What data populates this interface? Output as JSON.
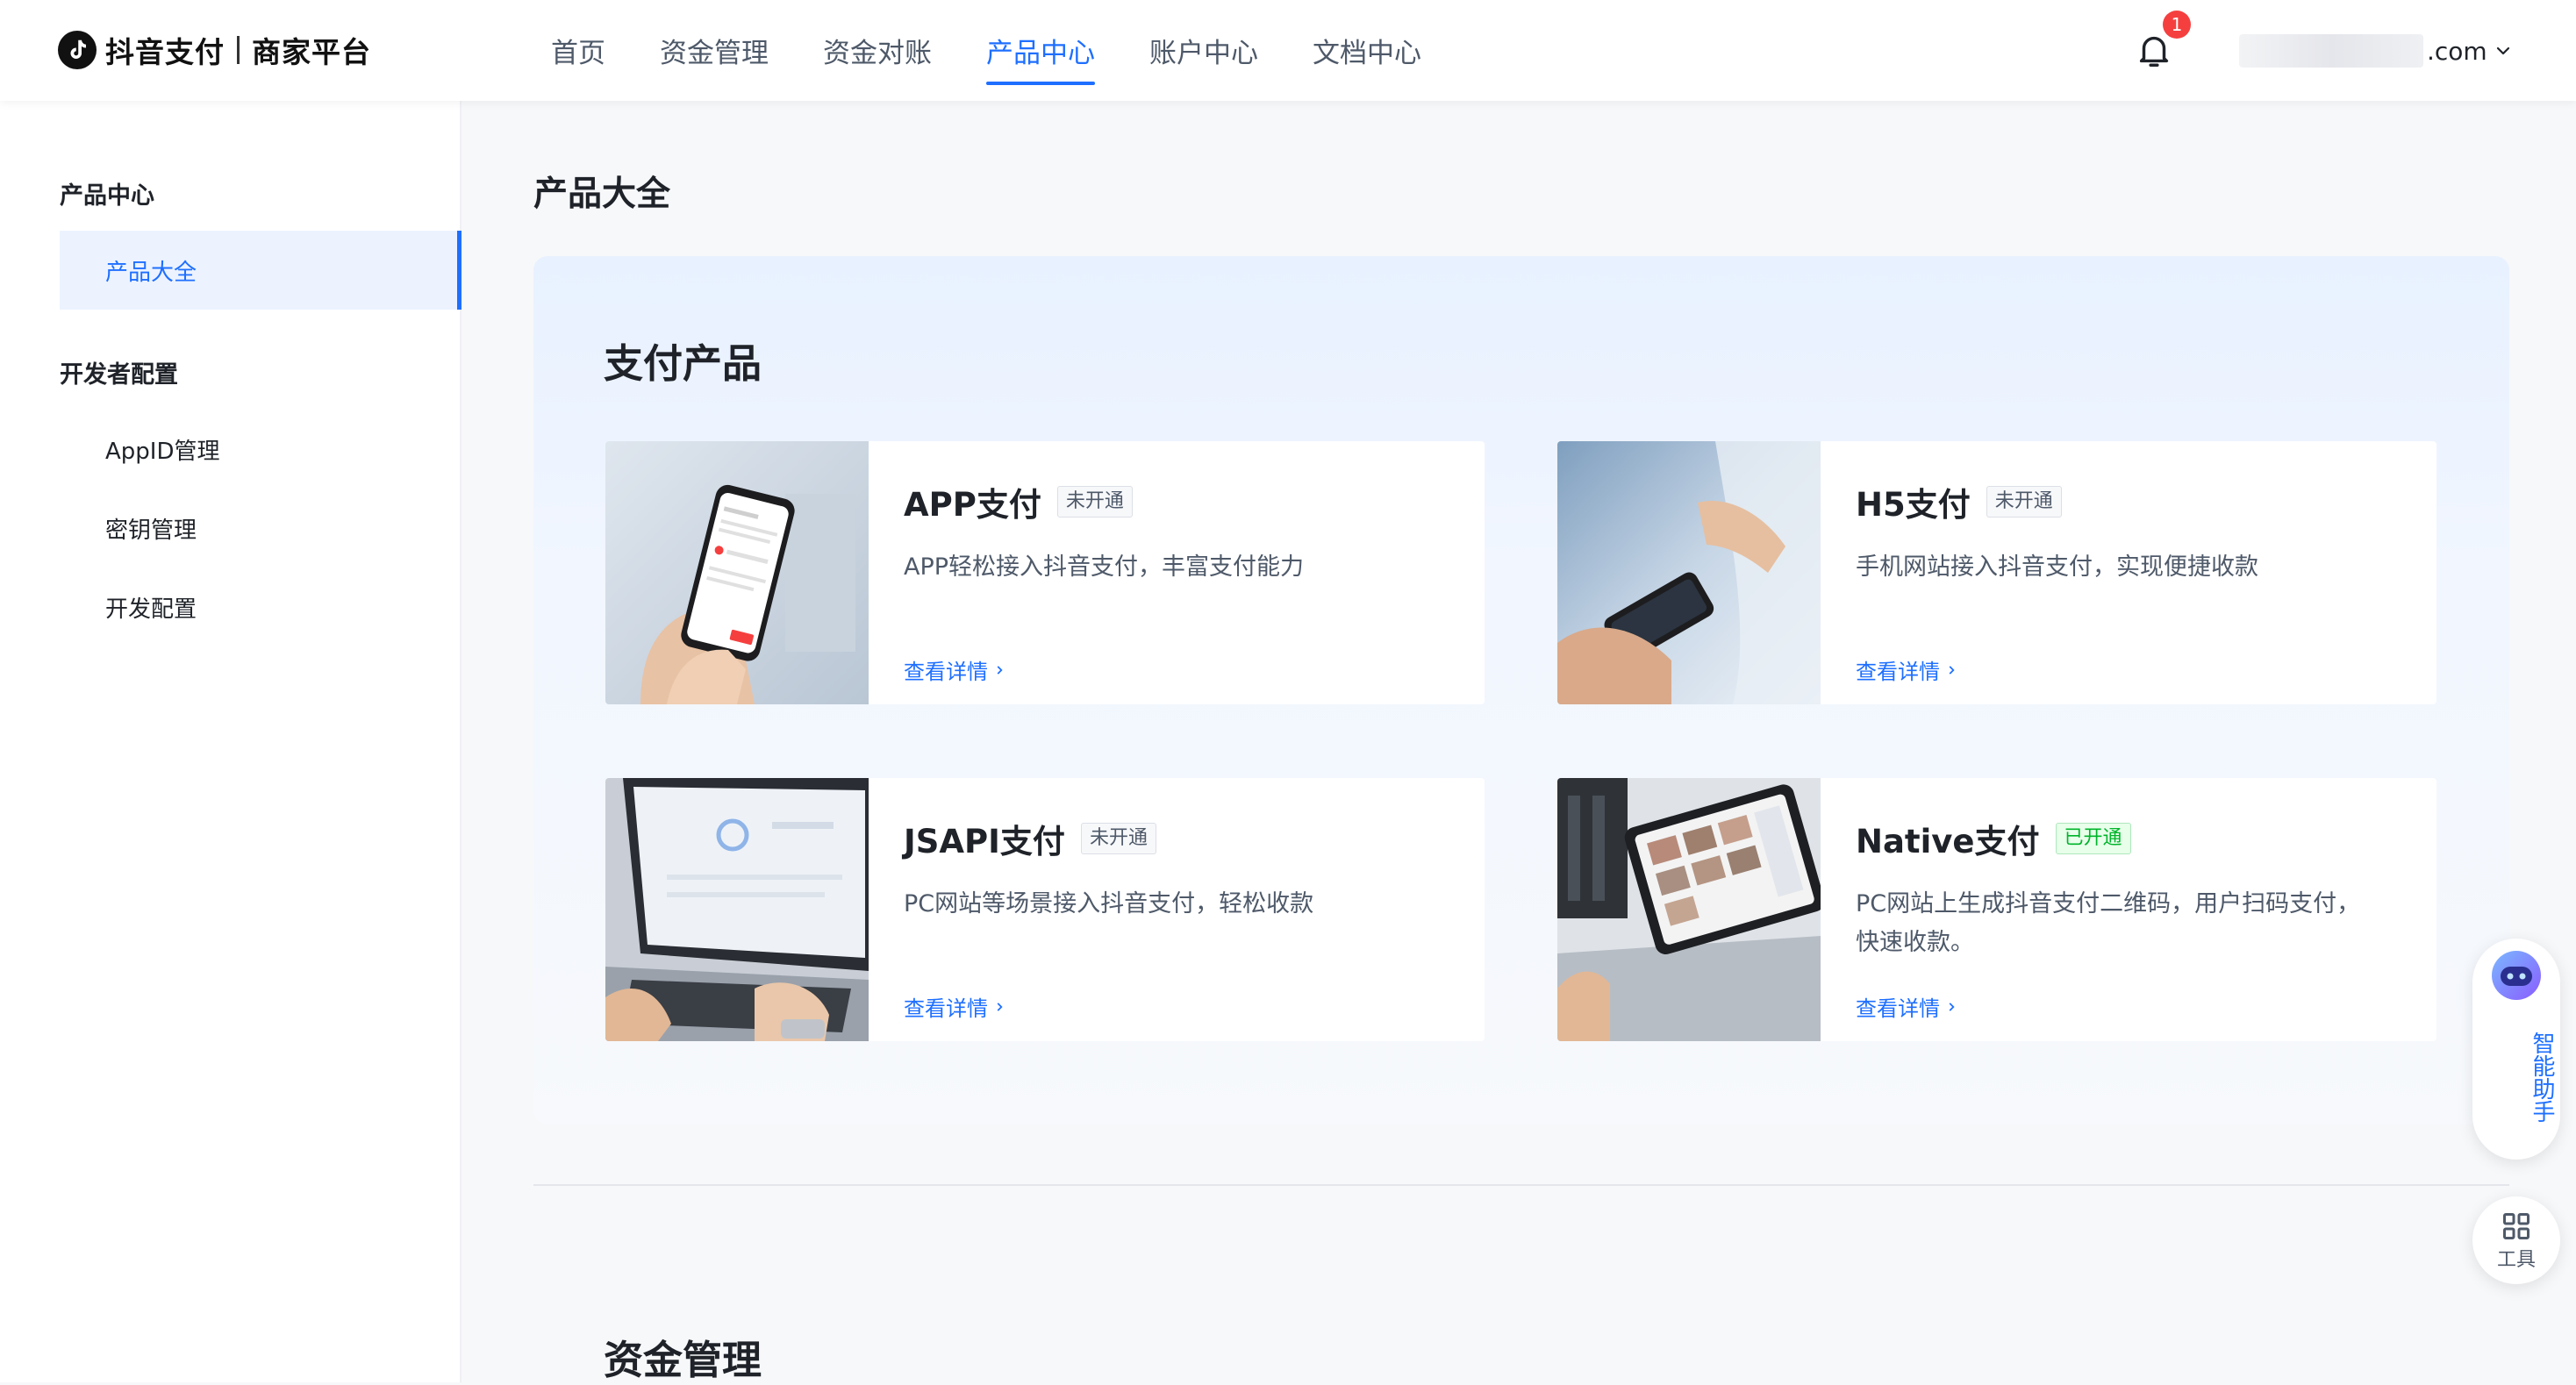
{
  "header": {
    "brand": "抖音支付",
    "brand_sub": "商家平台",
    "nav": [
      {
        "label": "首页",
        "active": false
      },
      {
        "label": "资金管理",
        "active": false
      },
      {
        "label": "资金对账",
        "active": false
      },
      {
        "label": "产品中心",
        "active": true
      },
      {
        "label": "账户中心",
        "active": false
      },
      {
        "label": "文档中心",
        "active": false
      }
    ],
    "notification_count": "1",
    "account_domain": ".com"
  },
  "sidebar": {
    "group1": "产品中心",
    "group1_items": [
      {
        "label": "产品大全",
        "active": true
      }
    ],
    "group2": "开发者配置",
    "group2_items": [
      {
        "label": "AppID管理",
        "active": false
      },
      {
        "label": "密钥管理",
        "active": false
      },
      {
        "label": "开发配置",
        "active": false
      }
    ]
  },
  "main": {
    "page_title": "产品大全",
    "section_payment": "支付产品",
    "section_funds": "资金管理",
    "cards": [
      {
        "title": "APP支付",
        "tag": "未开通",
        "tag_on": false,
        "desc": "APP轻松接入抖音支付，丰富支付能力",
        "link": "查看详情"
      },
      {
        "title": "H5支付",
        "tag": "未开通",
        "tag_on": false,
        "desc": "手机网站接入抖音支付，实现便捷收款",
        "link": "查看详情"
      },
      {
        "title": "JSAPI支付",
        "tag": "未开通",
        "tag_on": false,
        "desc": "PC网站等场景接入抖音支付，轻松收款",
        "link": "查看详情"
      },
      {
        "title": "Native支付",
        "tag": "已开通",
        "tag_on": true,
        "desc": "PC网站上生成抖音支付二维码，用户扫码支付，快速收款。",
        "link": "查看详情"
      }
    ]
  },
  "floating": {
    "assistant": "智能助手",
    "tools": "工具"
  },
  "colors": {
    "accent": "#1e6fff",
    "success": "#00b42a",
    "badge": "#f53f3f"
  }
}
